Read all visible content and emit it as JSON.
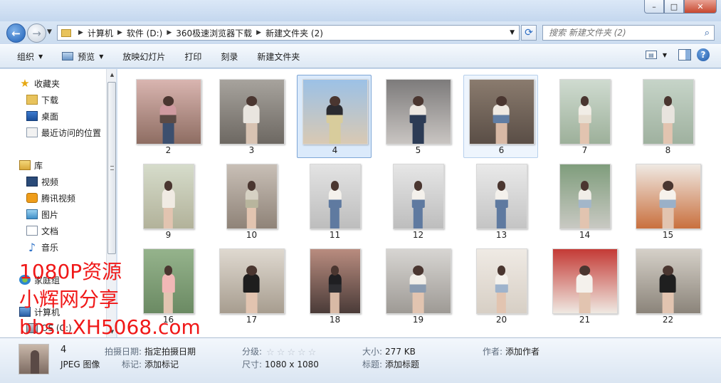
{
  "window": {
    "title": "",
    "buttons": {
      "minimize": "–",
      "maximize": "□",
      "close": "✕"
    }
  },
  "address_bar": {
    "back": "←",
    "forward": "→",
    "breadcrumbs": [
      "计算机",
      "软件 (D:)",
      "360极速浏览器下载",
      "新建文件夹 (2)"
    ],
    "search_placeholder": "搜索 新建文件夹 (2)"
  },
  "toolbar": {
    "organize": "组织",
    "preview": "预览",
    "slideshow": "放映幻灯片",
    "print": "打印",
    "burn": "刻录",
    "new_folder": "新建文件夹"
  },
  "nav": {
    "favorites": "收藏夹",
    "downloads": "下载",
    "desktop": "桌面",
    "recent": "最近访问的位置",
    "libraries": "库",
    "videos": "视频",
    "tencent_video": "腾讯视频",
    "pictures": "图片",
    "documents": "文档",
    "music": "音乐",
    "homegroup": "家庭组",
    "computer": "计算机",
    "drive_c": "OS (C:)"
  },
  "watermark": {
    "line1": "1080P资源",
    "line2": "小辉网分享",
    "line3": "bbs.LXH5068.com",
    "color": "#f01818"
  },
  "files": [
    {
      "name": "2",
      "bg": [
        "#d9b5b0",
        "#8e6d62"
      ],
      "top": "#cf9aa0",
      "bottom": "#5b4a45",
      "legs": "#3c4f6e"
    },
    {
      "name": "3",
      "bg": [
        "#a7a39d",
        "#6d6862"
      ],
      "top": "#e9e5df",
      "bottom": "#e9e5df",
      "legs": "#d8c3b2"
    },
    {
      "name": "4",
      "bg": [
        "#9cc1e6",
        "#d9c9b3"
      ],
      "top": "#2b2b30",
      "bottom": "#d8cc9c",
      "legs": "#d8cc9c"
    },
    {
      "name": "5",
      "bg": [
        "#7d7b7b",
        "#c9c5c2"
      ],
      "top": "#ede8e2",
      "bottom": "#2c3b55",
      "legs": "#2c3b55"
    },
    {
      "name": "6",
      "bg": [
        "#8a7b6e",
        "#5a4e46"
      ],
      "top": "#efe9e2",
      "bottom": "#607da3",
      "legs": "#d8b9a5"
    },
    {
      "name": "7",
      "bg": [
        "#cfdbd0",
        "#9db09a"
      ],
      "top": "#f1ede6",
      "bottom": "#e6ddd0",
      "legs": "#e2c4b0"
    },
    {
      "name": "8",
      "bg": [
        "#c6d4c8",
        "#9fb19f"
      ],
      "top": "#e8e4de",
      "bottom": "#e8e4de",
      "legs": "#e2c4b0"
    },
    {
      "name": "9",
      "bg": [
        "#d6dccb",
        "#b2b29a"
      ],
      "top": "#f0ebe3",
      "bottom": "#f0ebe3",
      "legs": "#e2c4b0"
    },
    {
      "name": "10",
      "bg": [
        "#c8bfb6",
        "#8f8378"
      ],
      "top": "#d6d1c3",
      "bottom": "#b8b59d",
      "legs": "#e2c4b0"
    },
    {
      "name": "11",
      "bg": [
        "#e3e3e3",
        "#bdbdbd"
      ],
      "top": "#f4f1ec",
      "bottom": "#5f7aa0",
      "legs": "#5f7aa0"
    },
    {
      "name": "12",
      "bg": [
        "#e6e6e6",
        "#bdbdbd"
      ],
      "top": "#f4f1ec",
      "bottom": "#5f7aa0",
      "legs": "#5f7aa0"
    },
    {
      "name": "13",
      "bg": [
        "#e9e9e9",
        "#c4c4c4"
      ],
      "top": "#f4f1ec",
      "bottom": "#5f7aa0",
      "legs": "#5f7aa0"
    },
    {
      "name": "14",
      "bg": [
        "#7f9d7c",
        "#c9c9c3"
      ],
      "top": "#f1eee8",
      "bottom": "#a3b6c9",
      "legs": "#e2c4b0"
    },
    {
      "name": "15",
      "bg": [
        "#efe9e3",
        "#c9703e"
      ],
      "top": "#f6f2ec",
      "bottom": "#9ab0c8",
      "legs": "#e2c4b0"
    },
    {
      "name": "16",
      "bg": [
        "#95b38c",
        "#6b8a63"
      ],
      "top": "#f1b8b6",
      "bottom": "#f1b8b6",
      "legs": "#e2c4b0"
    },
    {
      "name": "17",
      "bg": [
        "#dfd9d0",
        "#a79d8f"
      ],
      "top": "#1e1e1e",
      "bottom": "#1e1e1e",
      "legs": "#e2c4b0"
    },
    {
      "name": "18",
      "bg": [
        "#b98c7f",
        "#4a3b38"
      ],
      "top": "#1f1f22",
      "bottom": "#2d2d31",
      "legs": "#d8b9a5"
    },
    {
      "name": "19",
      "bg": [
        "#d7d5d2",
        "#9e9a95"
      ],
      "top": "#f2efe9",
      "bottom": "#8a9bb0",
      "legs": "#e2c4b0"
    },
    {
      "name": "20",
      "bg": [
        "#efeae4",
        "#d7cfc5"
      ],
      "top": "#f4f1ec",
      "bottom": "#9eb3cc",
      "legs": "#e2c4b0"
    },
    {
      "name": "21",
      "bg": [
        "#c43a35",
        "#efe9e2"
      ],
      "top": "#f4f1ec",
      "bottom": "#f4f1ec",
      "legs": "#e2c4b0"
    },
    {
      "name": "22",
      "bg": [
        "#d5d0c8",
        "#8b847a"
      ],
      "top": "#1f1f1f",
      "bottom": "#1f1f1f",
      "legs": "#e2c4b0"
    }
  ],
  "selection": {
    "selected": "4",
    "hovered": "6"
  },
  "details": {
    "name": "4",
    "type": "JPEG 图像",
    "date_taken_label": "拍摄日期:",
    "date_taken_value": "指定拍摄日期",
    "tags_label": "标记:",
    "tags_value": "添加标记",
    "rating_label": "分级:",
    "rating_stars": 0,
    "dimensions_label": "尺寸:",
    "dimensions_value": "1080 x 1080",
    "size_label": "大小:",
    "size_value": "277 KB",
    "title_label": "标题:",
    "title_value": "添加标题",
    "author_label": "作者:",
    "author_value": "添加作者"
  }
}
